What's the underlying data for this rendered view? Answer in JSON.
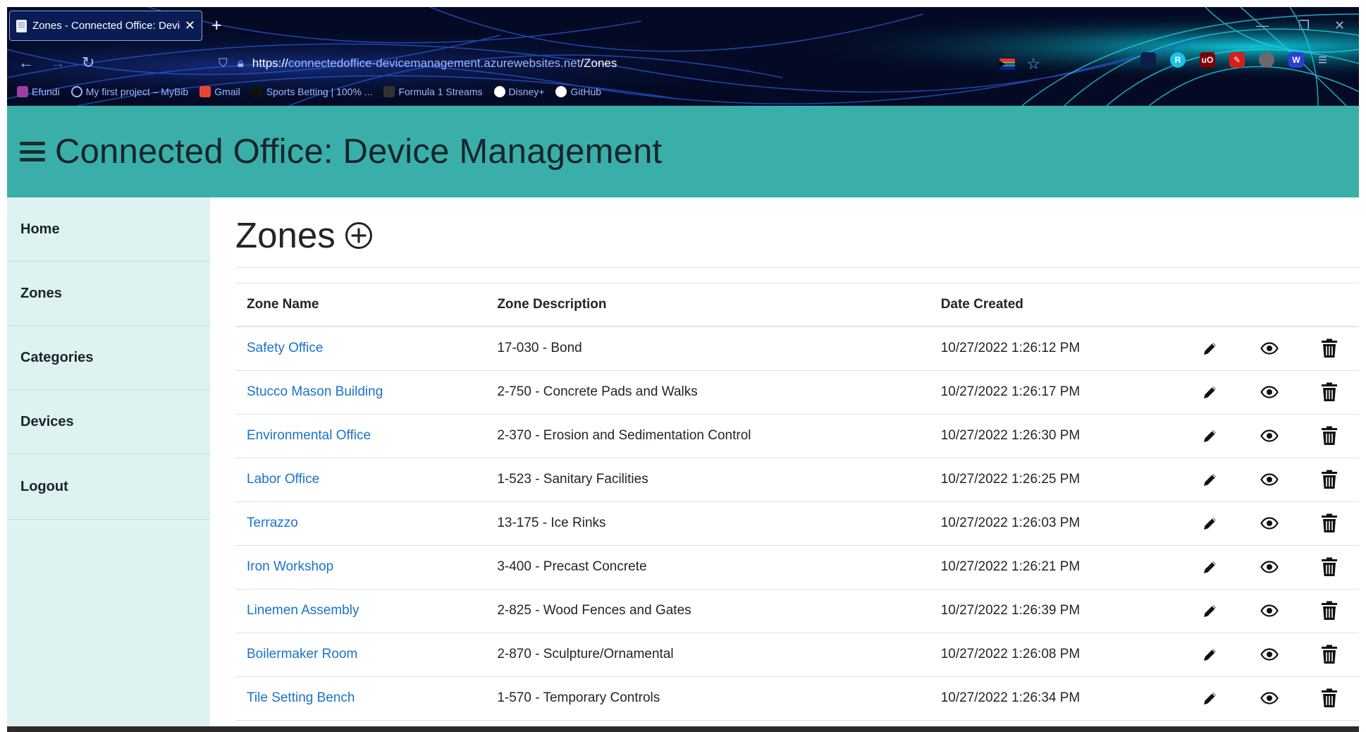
{
  "browser": {
    "tab_title": "Zones - Connected Office: Devic",
    "tab_close": "✕",
    "new_tab": "+",
    "window_controls": [
      "—",
      "❐",
      "✕"
    ],
    "url_scheme": "https://",
    "url_host": "connectedoffice-devicemanagement.azurewebsites.net",
    "url_path": "/Zones",
    "bookmarks": [
      {
        "label": "Efundi",
        "color": "#9b3fa0"
      },
      {
        "label": "My first project – MyBib",
        "color": "#9fb7ff"
      },
      {
        "label": "Gmail",
        "color": "#ea4335"
      },
      {
        "label": "Sports Betting | 100% ...",
        "color": "#111111"
      },
      {
        "label": "Formula 1 Streams",
        "color": "#333333"
      },
      {
        "label": "Disney+",
        "color": "#ffffff"
      },
      {
        "label": "GitHub",
        "color": "#ffffff"
      }
    ],
    "extensions": [
      {
        "icon": "pocket-icon",
        "text": "",
        "color": "#0b1f4f"
      },
      {
        "icon": "r-extension-icon",
        "text": "R",
        "color": "#18c2e8"
      },
      {
        "icon": "ublock-icon",
        "text": "uO",
        "color": "#800000"
      },
      {
        "icon": "pen-extension-icon",
        "text": "✎",
        "color": "#d81d1d"
      },
      {
        "icon": "circle-extension-icon",
        "text": "",
        "color": "#6a6a6a"
      },
      {
        "icon": "w-extension-icon",
        "text": "W",
        "color": "#2a3fd6"
      }
    ],
    "menu": "≡"
  },
  "site": {
    "title": "Connected Office: Device Management",
    "brand_color": "#3aafa9"
  },
  "sidebar": {
    "items": [
      {
        "label": "Home"
      },
      {
        "label": "Zones"
      },
      {
        "label": "Categories"
      },
      {
        "label": "Devices"
      },
      {
        "label": "Logout"
      }
    ]
  },
  "main": {
    "heading": "Zones",
    "columns": [
      "Zone Name",
      "Zone Description",
      "Date Created"
    ],
    "rows": [
      {
        "name": "Safety Office",
        "description": "17-030 - Bond",
        "created": "10/27/2022 1:26:12 PM"
      },
      {
        "name": "Stucco Mason Building",
        "description": "2-750 - Concrete Pads and Walks",
        "created": "10/27/2022 1:26:17 PM"
      },
      {
        "name": "Environmental Office",
        "description": "2-370 - Erosion and Sedimentation Control",
        "created": "10/27/2022 1:26:30 PM"
      },
      {
        "name": "Labor Office",
        "description": "1-523 - Sanitary Facilities",
        "created": "10/27/2022 1:26:25 PM"
      },
      {
        "name": "Terrazzo",
        "description": "13-175 - Ice Rinks",
        "created": "10/27/2022 1:26:03 PM"
      },
      {
        "name": "Iron Workshop",
        "description": "3-400 - Precast Concrete",
        "created": "10/27/2022 1:26:21 PM"
      },
      {
        "name": "Linemen Assembly",
        "description": "2-825 - Wood Fences and Gates",
        "created": "10/27/2022 1:26:39 PM"
      },
      {
        "name": "Boilermaker Room",
        "description": "2-870 - Sculpture/Ornamental",
        "created": "10/27/2022 1:26:08 PM"
      },
      {
        "name": "Tile Setting Bench",
        "description": "1-570 - Temporary Controls",
        "created": "10/27/2022 1:26:34 PM"
      }
    ]
  }
}
